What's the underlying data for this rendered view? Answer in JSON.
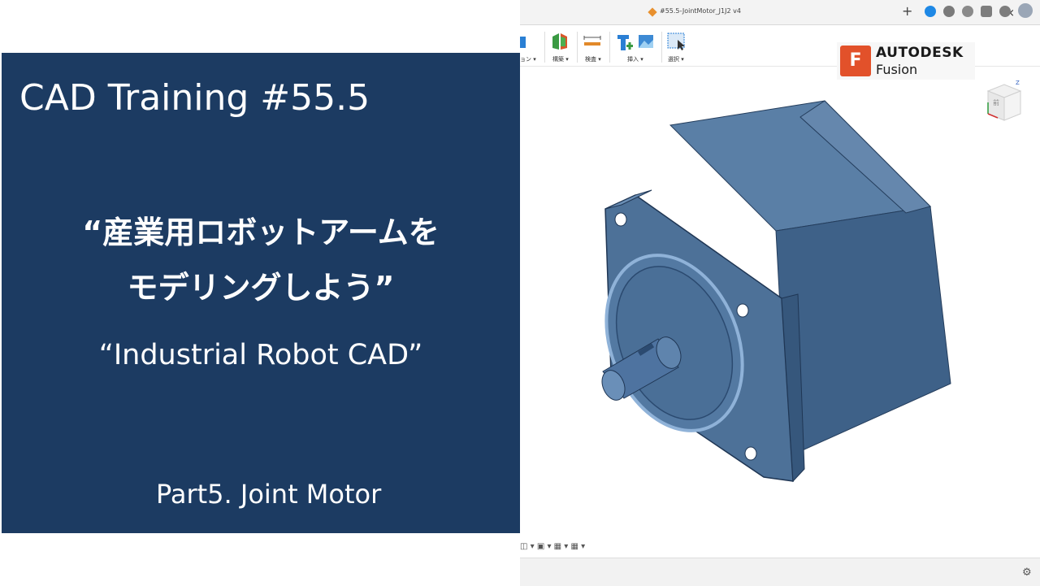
{
  "slide": {
    "title": "CAD Training #55.5",
    "jp_line1": "“産業用ロボットアームを",
    "jp_line2": "モデリングしよう”",
    "en_title": "“Industrial Robot CAD”",
    "part": "Part5. Joint Motor"
  },
  "fusion": {
    "tab_title": "#55.5-JointMotor_J1J2 v4",
    "close_glyph": "×",
    "add_glyph": "+",
    "toolbar": {
      "construct_label": "ョン ▾",
      "assemble_label": "構築 ▾",
      "inspect_label": "検査 ▾",
      "insert_label": "挿入 ▾",
      "select_label": "選択 ▾"
    },
    "logo": {
      "letter": "F",
      "brand": "AUTODESK",
      "product": "Fusion"
    },
    "viewcube_label": "前",
    "bottom_glyphs": "◫ ▾ ▣ ▾ ▦ ▾ ▦ ▾",
    "settings_glyph": "⚙"
  },
  "colors": {
    "panel": "#1c3b62",
    "motor": "#46698f",
    "accent": "#e2512a"
  }
}
